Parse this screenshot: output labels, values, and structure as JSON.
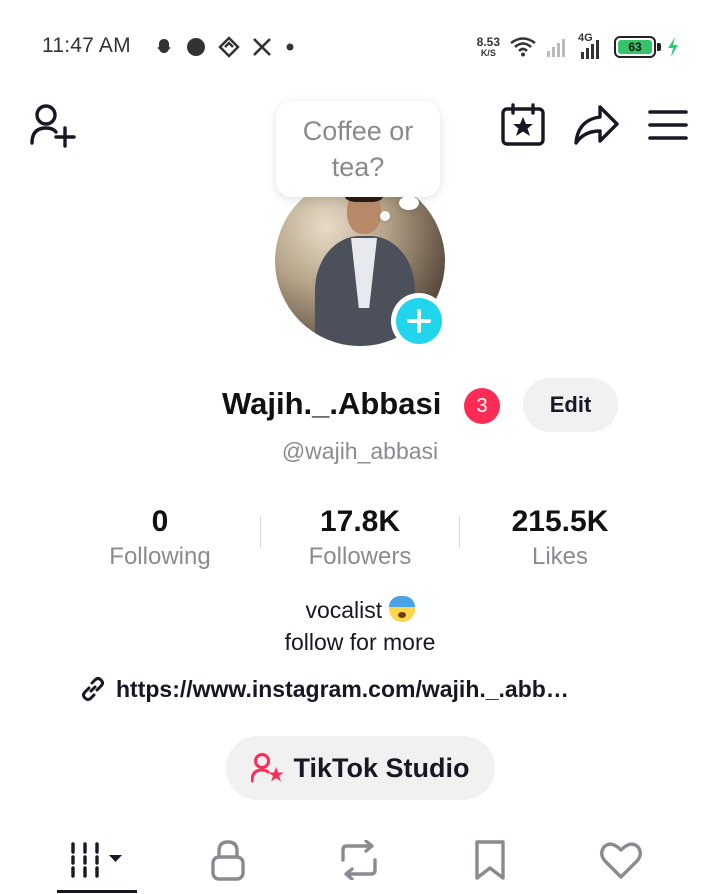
{
  "status_bar": {
    "time": "11:47 AM",
    "net_speed": "8.53",
    "net_speed_unit": "K/S",
    "network": "4G",
    "battery": "63",
    "icons": [
      "snapchat-icon",
      "circle-icon",
      "vpn-icon",
      "x-icon",
      "dot-icon",
      "wifi-icon",
      "signal-icon",
      "signal-4g-icon",
      "battery-icon",
      "charging-icon"
    ]
  },
  "header": {
    "icons": [
      "add-friend-icon",
      "calendar-star-icon",
      "share-icon",
      "menu-icon"
    ]
  },
  "bubble": {
    "text": "Coffee or tea?"
  },
  "profile": {
    "username": "Wajih._.Abbasi",
    "notifications": "3",
    "edit_label": "Edit",
    "handle": "@wajih_abbasi"
  },
  "stats": [
    {
      "value": "0",
      "label": "Following"
    },
    {
      "value": "17.8K",
      "label": "Followers"
    },
    {
      "value": "215.5K",
      "label": "Likes"
    }
  ],
  "bio": {
    "line1": "vocalist",
    "line2": "follow for more",
    "link": "https://www.instagram.com/wajih._.abb…"
  },
  "studio": {
    "label": "TikTok Studio"
  },
  "tabs": [
    "videos-grid-icon",
    "lock-icon",
    "repost-icon",
    "bookmark-icon",
    "heart-icon"
  ],
  "colors": {
    "accent_red": "#fe2c55",
    "avatar_add": "#20d5ec",
    "muted_text": "#8a8b91",
    "button_bg": "#f1f1f2"
  }
}
